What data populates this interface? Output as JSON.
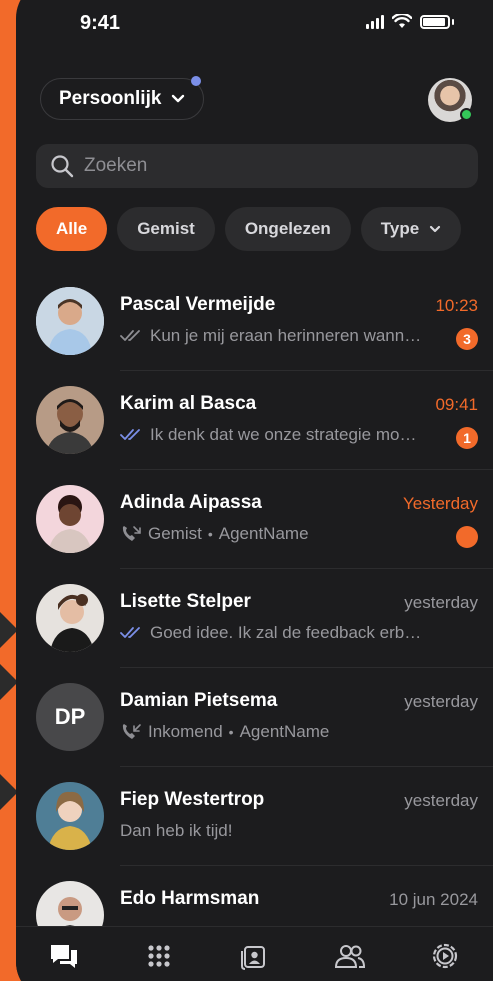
{
  "status_bar": {
    "time": "9:41"
  },
  "header": {
    "account_label": "Persoonlijk",
    "account_has_notification": true,
    "user_online": true
  },
  "search": {
    "placeholder": "Zoeken"
  },
  "filters": [
    {
      "label": "Alle",
      "active": true
    },
    {
      "label": "Gemist",
      "active": false
    },
    {
      "label": "Ongelezen",
      "active": false
    },
    {
      "label": "Type",
      "active": false,
      "has_dropdown": true
    }
  ],
  "conversations": [
    {
      "name": "Pascal Vermeijde",
      "time": "10:23",
      "time_highlight": true,
      "icon": "double-check-grey-icon",
      "preview": "Kun je mij eraan herinneren wann…",
      "badge": "3"
    },
    {
      "name": "Karim al Basca",
      "time": "09:41",
      "time_highlight": true,
      "icon": "double-check-blue-icon",
      "preview": "Ik denk dat we onze strategie mo…",
      "badge": "1"
    },
    {
      "name": "Adinda Aipassa",
      "time": "Yesterday",
      "time_highlight": true,
      "icon": "missed-call-icon",
      "preview": "Gemist",
      "agent": "AgentName",
      "unread_dot": true
    },
    {
      "name": "Lisette Stelper",
      "time": "yesterday",
      "time_highlight": false,
      "icon": "double-check-blue-icon",
      "preview": "Goed idee. Ik zal de feedback erb…"
    },
    {
      "name": "Damian Pietsema",
      "initials": "DP",
      "time": "yesterday",
      "time_highlight": false,
      "icon": "incoming-call-icon",
      "preview": "Inkomend",
      "agent": "AgentName"
    },
    {
      "name": "Fiep Westertrop",
      "time": "yesterday",
      "time_highlight": false,
      "preview": "Dan heb ik tijd!"
    },
    {
      "name": "Edo Harmsman",
      "time": "10 jun 2024",
      "time_highlight": false
    }
  ],
  "tab_bar": [
    {
      "icon": "chat-icon",
      "active": true
    },
    {
      "icon": "keypad-icon",
      "active": false
    },
    {
      "icon": "contact-card-icon",
      "active": false
    },
    {
      "icon": "people-icon",
      "active": false
    },
    {
      "icon": "settings-icon",
      "active": false
    }
  ],
  "colors": {
    "accent": "#f26a2a",
    "background": "#1c1c1e",
    "surface": "#2c2c2e",
    "read_blue": "#7b8fe8",
    "online": "#34c759"
  }
}
